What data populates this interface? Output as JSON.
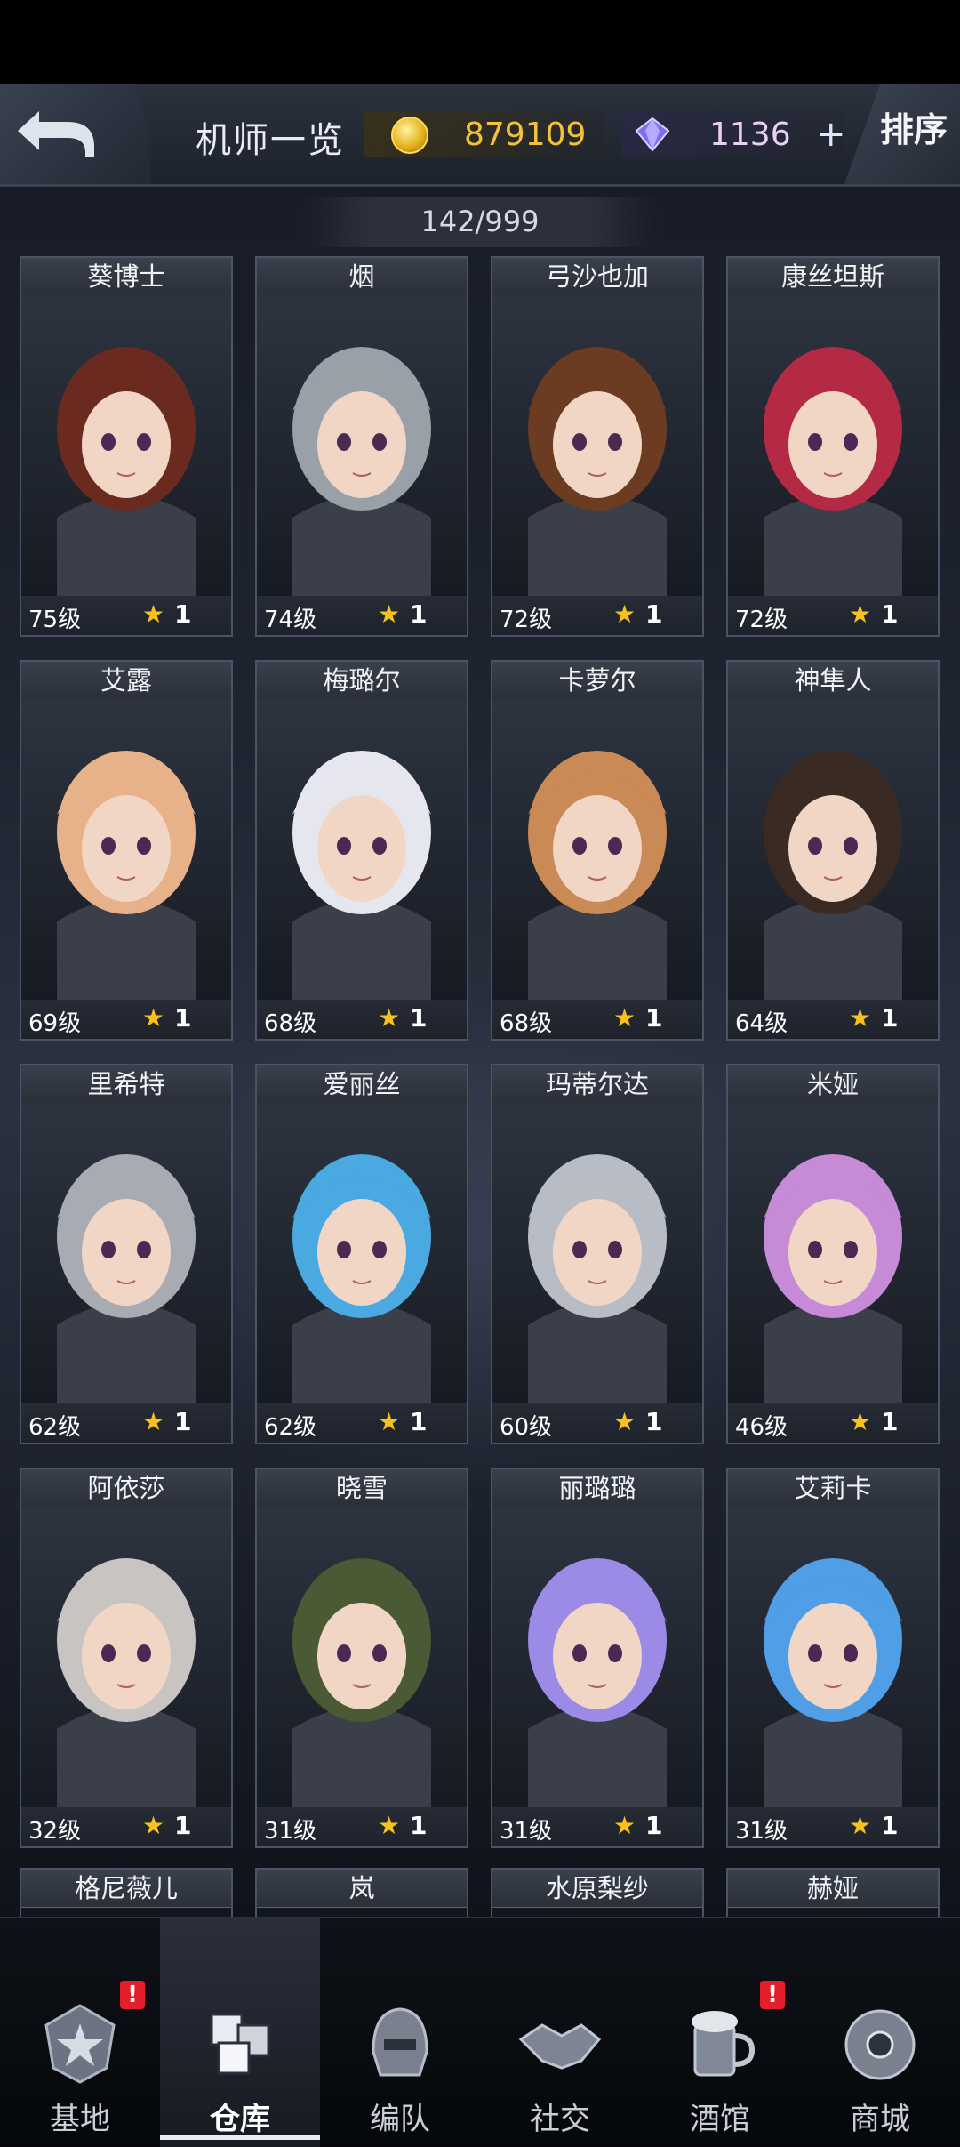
{
  "header": {
    "title": "机师一览",
    "coins": "879109",
    "gems": "1136",
    "plus": "+",
    "sort_label": "排序",
    "count": "142/999"
  },
  "pilots": [
    {
      "name": "葵博士",
      "level": "75级",
      "stars": "1",
      "color": "#6b2a20"
    },
    {
      "name": "烟",
      "level": "74级",
      "stars": "1",
      "color": "#9aa0a8"
    },
    {
      "name": "弓沙也加",
      "level": "72级",
      "stars": "1",
      "color": "#6b3b22"
    },
    {
      "name": "康丝坦斯",
      "level": "72级",
      "stars": "1",
      "color": "#b42a45"
    },
    {
      "name": "艾露",
      "level": "69级",
      "stars": "1",
      "color": "#e7b28a"
    },
    {
      "name": "梅璐尔",
      "level": "68级",
      "stars": "1",
      "color": "#e6e6ee"
    },
    {
      "name": "卡萝尔",
      "level": "68级",
      "stars": "1",
      "color": "#c98a56"
    },
    {
      "name": "神隼人",
      "level": "64级",
      "stars": "1",
      "color": "#3a2a24"
    },
    {
      "name": "里希特",
      "level": "62级",
      "stars": "1",
      "color": "#a8acb2"
    },
    {
      "name": "爱丽丝",
      "level": "62级",
      "stars": "1",
      "color": "#4aa9e0"
    },
    {
      "name": "玛蒂尔达",
      "level": "60级",
      "stars": "1",
      "color": "#b8bcc4"
    },
    {
      "name": "米娅",
      "level": "46级",
      "stars": "1",
      "color": "#c68ad6"
    },
    {
      "name": "阿依莎",
      "level": "32级",
      "stars": "1",
      "color": "#c8c4c2"
    },
    {
      "name": "晓雪",
      "level": "31级",
      "stars": "1",
      "color": "#4a5a34"
    },
    {
      "name": "丽璐璐",
      "level": "31级",
      "stars": "1",
      "color": "#9b8ae6"
    },
    {
      "name": "艾莉卡",
      "level": "31级",
      "stars": "1",
      "color": "#4f9ee6"
    }
  ],
  "partial_row": [
    "格尼薇儿",
    "岚",
    "水原梨纱",
    "赫娅"
  ],
  "nav": [
    {
      "label": "基地",
      "icon": "base-emblem-icon",
      "alert": "!"
    },
    {
      "label": "仓库",
      "icon": "warehouse-cubes-icon",
      "alert": ""
    },
    {
      "label": "编队",
      "icon": "mech-helmet-icon",
      "alert": ""
    },
    {
      "label": "社交",
      "icon": "handshake-icon",
      "alert": ""
    },
    {
      "label": "酒馆",
      "icon": "beer-mug-icon",
      "alert": "!"
    },
    {
      "label": "商城",
      "icon": "shop-capsule-icon",
      "alert": ""
    }
  ],
  "colors": {
    "coin": "#f4c238",
    "gem_text": "#e8d0f5",
    "star": "#f7c21f",
    "alert": "#e41f2b"
  }
}
